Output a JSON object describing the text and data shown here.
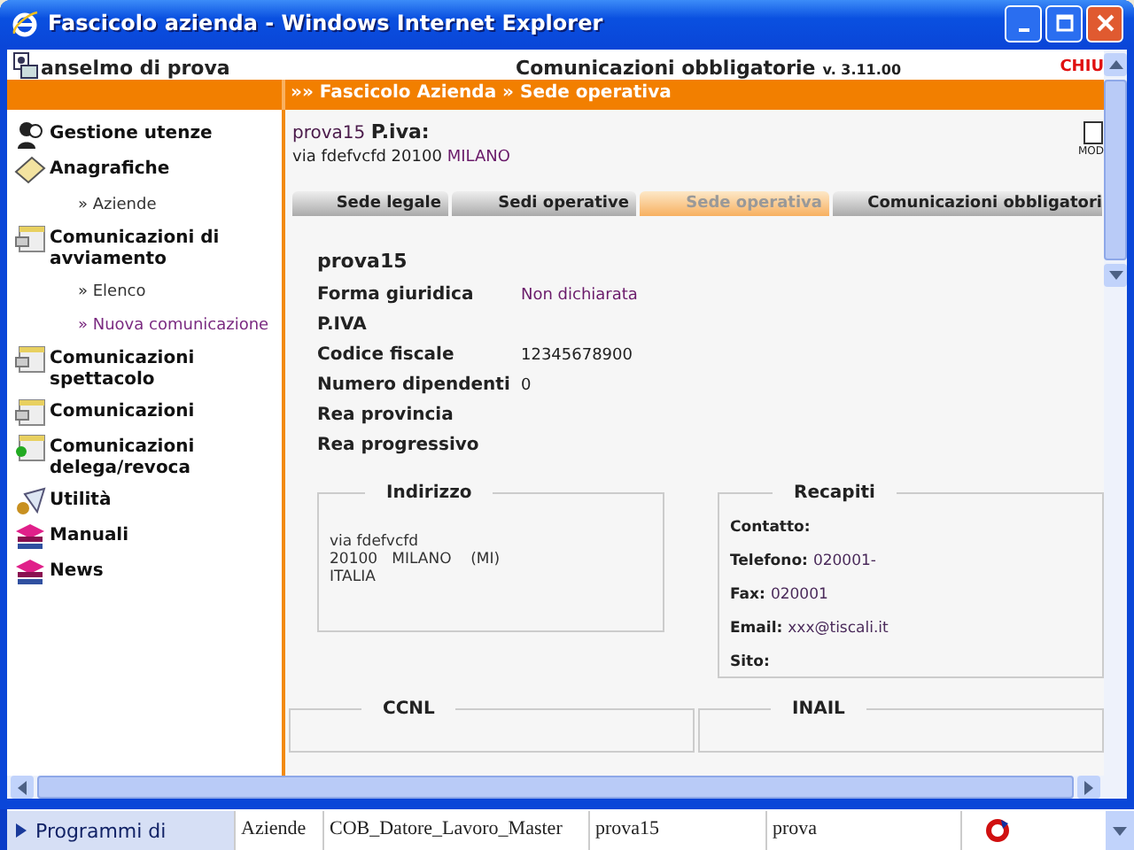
{
  "window": {
    "title": "Fascicolo azienda - Windows Internet Explorer"
  },
  "header": {
    "user": "anselmo di prova",
    "app_title": "Comunicazioni obbligatorie",
    "version": "v. 3.11.00",
    "logout": "CHIU"
  },
  "breadcrumb": "»» Fascicolo Azienda » Sede operativa",
  "sidebar": {
    "items": [
      {
        "label": "Gestione utenze"
      },
      {
        "label": "Anagrafiche",
        "children": [
          {
            "label": "» Aziende",
            "visited": false
          }
        ]
      },
      {
        "label": "Comunicazioni di avviamento",
        "children": [
          {
            "label": "» Elenco",
            "visited": false
          },
          {
            "label": "» Nuova comunicazione",
            "visited": true
          }
        ]
      },
      {
        "label": "Comunicazioni spettacolo"
      },
      {
        "label": "Comunicazioni"
      },
      {
        "label": "Comunicazioni delega/revoca"
      },
      {
        "label": "Utilità"
      },
      {
        "label": "Manuali"
      },
      {
        "label": "News"
      }
    ]
  },
  "company": {
    "name": "prova15",
    "piva_label": "P.iva:",
    "address_street": "via fdefvcfd 20100",
    "address_city": "MILANO",
    "modify_label": "MOD"
  },
  "tabs": [
    {
      "label": "Sede legale",
      "selected": false
    },
    {
      "label": "Sedi operative",
      "selected": false
    },
    {
      "label": "Sede operativa",
      "selected": true
    },
    {
      "label": "Comunicazioni obbligatori",
      "selected": false
    }
  ],
  "details": {
    "title": "prova15",
    "fields": [
      {
        "label": "Forma giuridica",
        "value": "Non dichiarata"
      },
      {
        "label": "P.IVA"
      },
      {
        "label": "Codice fiscale",
        "value": "12345678900"
      },
      {
        "label": "Numero dipendenti",
        "value": "0"
      },
      {
        "label": "Rea provincia"
      },
      {
        "label": "Rea progressivo"
      }
    ]
  },
  "indirizzo": {
    "title": "Indirizzo",
    "lines": [
      "via fdefvcfd",
      "20100   MILANO    (MI)",
      "ITALIA"
    ]
  },
  "recapiti": {
    "title": "Recapiti",
    "fields": [
      {
        "label": "Contatto:"
      },
      {
        "label": "Telefono:",
        "value": "020001-"
      },
      {
        "label": "Fax:",
        "value": "020001"
      },
      {
        "label": "Email:",
        "value": "xxx@tiscali.it"
      },
      {
        "label": "Sito:"
      }
    ]
  },
  "lower_sections": [
    "CCNL",
    "INAIL"
  ],
  "background_window": {
    "sidebar_item": "Programmi di",
    "row": [
      "Aziende",
      "COB_Datore_Lavoro_Master",
      "prova15",
      "prova"
    ]
  }
}
